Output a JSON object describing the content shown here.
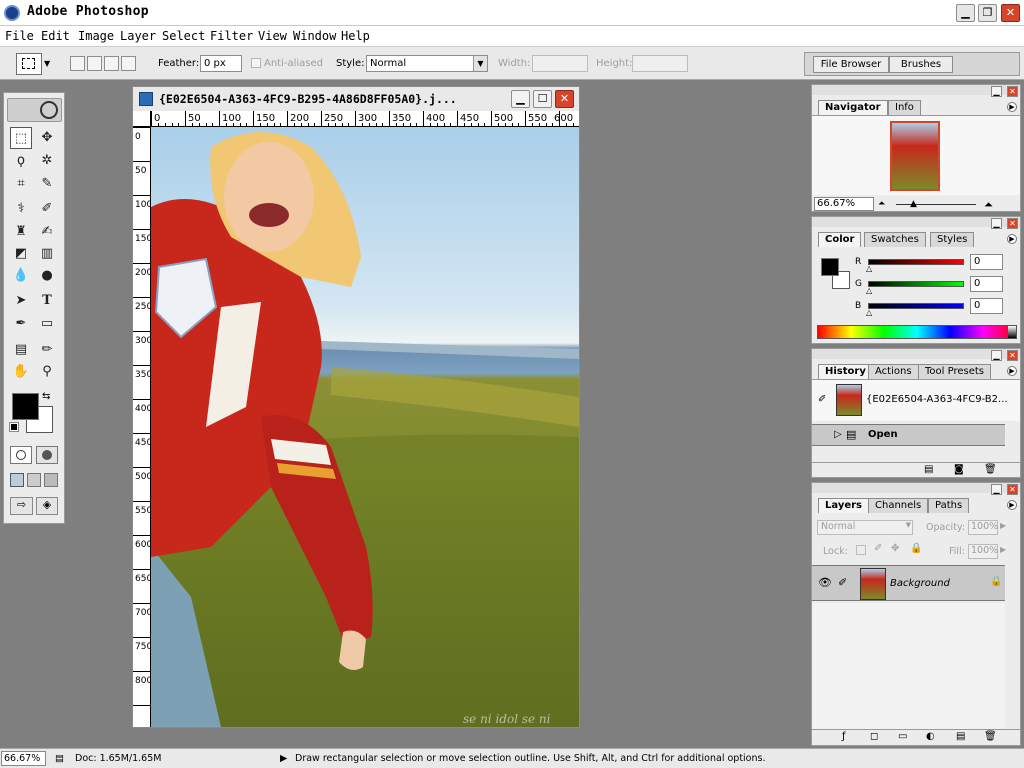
{
  "app": {
    "title": "Adobe Photoshop"
  },
  "menu": [
    "File",
    "Edit",
    "Image",
    "Layer",
    "Select",
    "Filter",
    "View",
    "Window",
    "Help"
  ],
  "options": {
    "feather_label": "Feather:",
    "feather_value": "0 px",
    "antialiased_label": "Anti-aliased",
    "style_label": "Style:",
    "style_value": "Normal",
    "width_label": "Width:",
    "height_label": "Height:"
  },
  "well_tabs": [
    "File Browser",
    "Brushes"
  ],
  "document": {
    "title": "{E02E6504-A363-4FC9-B295-4A86D8FF05A0}.j...",
    "ruler_h": [
      "0",
      "50",
      "100",
      "150",
      "200",
      "250",
      "300",
      "350",
      "400",
      "450",
      "500",
      "550",
      "600"
    ],
    "ruler_v": [
      "0",
      "50",
      "100",
      "150",
      "200",
      "250",
      "300",
      "350",
      "400",
      "450",
      "500",
      "550",
      "600",
      "650",
      "700",
      "750",
      "800"
    ],
    "watermark": "se ni idol se ni"
  },
  "navigator": {
    "tabs": [
      "Navigator",
      "Info"
    ],
    "zoom": "66.67%"
  },
  "color": {
    "tabs": [
      "Color",
      "Swatches",
      "Styles"
    ],
    "channels": [
      {
        "label": "R",
        "value": "0"
      },
      {
        "label": "G",
        "value": "0"
      },
      {
        "label": "B",
        "value": "0"
      }
    ]
  },
  "history": {
    "tabs": [
      "History",
      "Actions",
      "Tool Presets"
    ],
    "snapshot": "{E02E6504-A363-4FC9-B2...",
    "step": "Open"
  },
  "layers": {
    "tabs": [
      "Layers",
      "Channels",
      "Paths"
    ],
    "blend_mode": "Normal",
    "opacity_label": "Opacity:",
    "opacity_value": "100%",
    "lock_label": "Lock:",
    "fill_label": "Fill:",
    "fill_value": "100%",
    "layer_name": "Background"
  },
  "status": {
    "zoom": "66.67%",
    "doc": "Doc: 1.65M/1.65M",
    "hint": "Draw rectangular selection or move selection outline.  Use Shift, Alt, and Ctrl for additional options."
  },
  "colors": {
    "close_red": "#d6452a",
    "foreground": "#000000",
    "background": "#ffffff"
  }
}
